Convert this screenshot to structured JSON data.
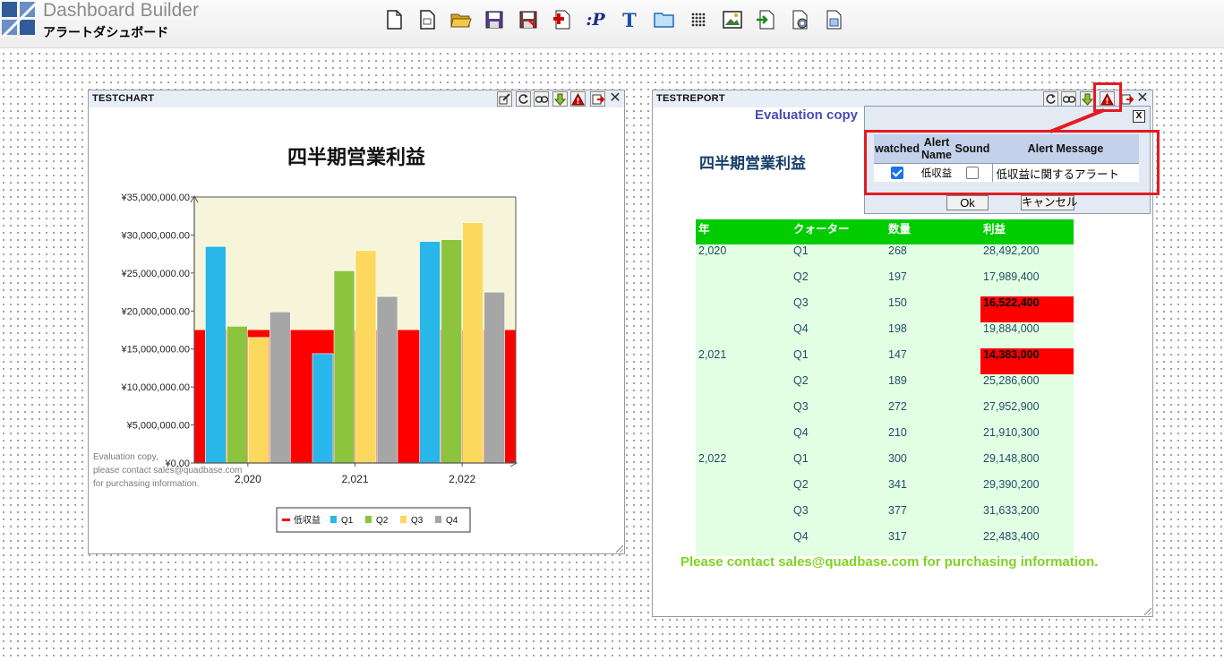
{
  "app": {
    "title": "Dashboard Builder",
    "subtitle": "アラートダシュボード"
  },
  "toolbar": {
    "buttons": [
      "new-icon",
      "new-page-icon",
      "open-folder-icon",
      "save-icon",
      "save-as-icon",
      "add-chart-icon",
      "parameter-icon",
      "text-icon",
      "folder-icon",
      "grid-icon",
      "image-icon",
      "export-icon",
      "settings-icon",
      "properties-icon"
    ],
    "parameter_label": ":P",
    "text_label": "T"
  },
  "chart_panel": {
    "title": "TESTCHART",
    "watermark": [
      "Evaluation copy,",
      "please contact sales@quadbase.com",
      "for purchasing information."
    ]
  },
  "chart_data": {
    "type": "bar",
    "title": "四半期営業利益",
    "categories": [
      "2,020",
      "2,021",
      "2,022"
    ],
    "series": [
      {
        "name": "Q1",
        "values": [
          28492200,
          14383000,
          29148800
        ],
        "color": "#29b6e8"
      },
      {
        "name": "Q2",
        "values": [
          17989400,
          25286600,
          29390200
        ],
        "color": "#8cc43d"
      },
      {
        "name": "Q3",
        "values": [
          16522400,
          27952900,
          31633200
        ],
        "color": "#fcd95c"
      },
      {
        "name": "Q4",
        "values": [
          19884000,
          21910300,
          22483400
        ],
        "color": "#a6a6a6"
      }
    ],
    "threshold": {
      "name": "低収益",
      "value": 17500000,
      "color": "#ff0000"
    },
    "ylim": [
      0,
      35000000
    ],
    "yticks": [
      "¥0.00",
      "¥5,000,000.00",
      "¥10,000,000.00",
      "¥15,000,000.00",
      "¥20,000,000.00",
      "¥25,000,000.00",
      "¥30,000,000.00",
      "¥35,000,000.00"
    ],
    "plot_background": "#f7f5d9",
    "legend_position": "bottom",
    "legend": [
      "低収益",
      "Q1",
      "Q2",
      "Q3",
      "Q4"
    ]
  },
  "report_panel": {
    "title": "TESTREPORT",
    "eval_text": "Evaluation copy",
    "report_title": "四半期営業利益",
    "columns": [
      "年",
      "クォーター",
      "数量",
      "利益"
    ],
    "rows": [
      [
        "2,020",
        "Q1",
        "268",
        "28,492,200"
      ],
      [
        "",
        "Q2",
        "197",
        "17,989,400"
      ],
      [
        "",
        "Q3",
        "150",
        "16,522,400"
      ],
      [
        "",
        "Q4",
        "198",
        "19,884,000"
      ],
      [
        "2,021",
        "Q1",
        "147",
        "14,383,000"
      ],
      [
        "",
        "Q2",
        "189",
        "25,286,600"
      ],
      [
        "",
        "Q3",
        "272",
        "27,952,900"
      ],
      [
        "",
        "Q4",
        "210",
        "21,910,300"
      ],
      [
        "2,022",
        "Q1",
        "300",
        "29,148,800"
      ],
      [
        "",
        "Q2",
        "341",
        "29,390,200"
      ],
      [
        "",
        "Q3",
        "377",
        "31,633,200"
      ],
      [
        "",
        "Q4",
        "317",
        "22,483,400"
      ]
    ],
    "alert_rows": [
      2,
      4
    ],
    "contact": "Please contact sales@quadbase.com for purchasing information."
  },
  "alert_dialog": {
    "close_label": "X",
    "headers": {
      "watched": "watched",
      "name": "Alert Name",
      "sound": "Sound",
      "message": "Alert Message"
    },
    "row": {
      "watched": true,
      "name": "低収益",
      "sound": false,
      "message": "低収益に関するアラート"
    },
    "ok_label": "Ok",
    "cancel_label": "キャンセル"
  },
  "colors": {
    "highlight": "#e31b23",
    "report_header": "#00cc00",
    "report_row": "#e3ffe3",
    "alert": "#ff0000"
  }
}
